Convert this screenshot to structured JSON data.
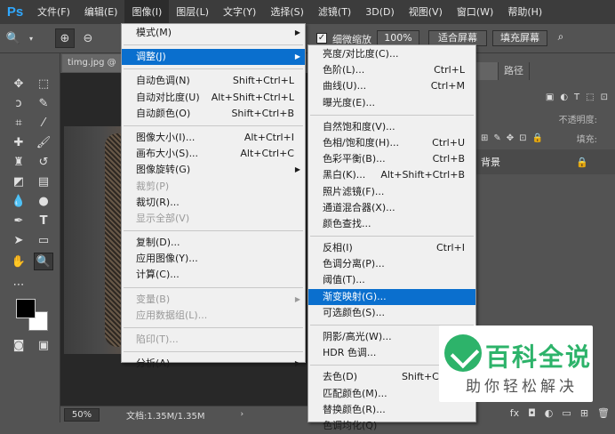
{
  "app": {
    "logo": "Ps"
  },
  "menubar": [
    {
      "label": "文件(F)"
    },
    {
      "label": "编辑(E)"
    },
    {
      "label": "图像(I)"
    },
    {
      "label": "图层(L)"
    },
    {
      "label": "文字(Y)"
    },
    {
      "label": "选择(S)"
    },
    {
      "label": "滤镜(T)"
    },
    {
      "label": "3D(D)"
    },
    {
      "label": "视图(V)"
    },
    {
      "label": "窗口(W)"
    },
    {
      "label": "帮助(H)"
    }
  ],
  "options": {
    "checkbox_label": "细微缩放",
    "zoom_value": "100%",
    "fit_screen": "适合屏幕",
    "fill_screen": "填充屏幕"
  },
  "document": {
    "tab": "timg.jpg @",
    "zoom": "50%",
    "doc_info": "文档:1.35M/1.35M"
  },
  "panel": {
    "tabs": [
      "",
      "路径"
    ],
    "opacity_label": "不透明度:",
    "fill_label": "填充:",
    "layer_name": "背景"
  },
  "image_menu": [
    {
      "label": "模式(M)",
      "shortcut": "",
      "submenu": true
    },
    {
      "sep": true
    },
    {
      "label": "调整(J)",
      "shortcut": "",
      "submenu": true,
      "highlight": true
    },
    {
      "sep": true
    },
    {
      "label": "自动色调(N)",
      "shortcut": "Shift+Ctrl+L"
    },
    {
      "label": "自动对比度(U)",
      "shortcut": "Alt+Shift+Ctrl+L"
    },
    {
      "label": "自动颜色(O)",
      "shortcut": "Shift+Ctrl+B"
    },
    {
      "sep": true
    },
    {
      "label": "图像大小(I)...",
      "shortcut": "Alt+Ctrl+I"
    },
    {
      "label": "画布大小(S)...",
      "shortcut": "Alt+Ctrl+C"
    },
    {
      "label": "图像旋转(G)",
      "shortcut": "",
      "submenu": true
    },
    {
      "label": "裁剪(P)",
      "shortcut": "",
      "disabled": true
    },
    {
      "label": "裁切(R)...",
      "shortcut": ""
    },
    {
      "label": "显示全部(V)",
      "shortcut": "",
      "disabled": true
    },
    {
      "sep": true
    },
    {
      "label": "复制(D)...",
      "shortcut": ""
    },
    {
      "label": "应用图像(Y)...",
      "shortcut": ""
    },
    {
      "label": "计算(C)...",
      "shortcut": ""
    },
    {
      "sep": true
    },
    {
      "label": "变量(B)",
      "shortcut": "",
      "submenu": true,
      "disabled": true
    },
    {
      "label": "应用数据组(L)...",
      "shortcut": "",
      "disabled": true
    },
    {
      "sep": true
    },
    {
      "label": "陷印(T)...",
      "shortcut": "",
      "disabled": true
    },
    {
      "sep": true
    },
    {
      "label": "分析(A)",
      "shortcut": "",
      "submenu": true
    }
  ],
  "adjust_menu": [
    {
      "label": "亮度/对比度(C)...",
      "shortcut": ""
    },
    {
      "label": "色阶(L)...",
      "shortcut": "Ctrl+L"
    },
    {
      "label": "曲线(U)...",
      "shortcut": "Ctrl+M"
    },
    {
      "label": "曝光度(E)...",
      "shortcut": ""
    },
    {
      "sep": true
    },
    {
      "label": "自然饱和度(V)...",
      "shortcut": ""
    },
    {
      "label": "色相/饱和度(H)...",
      "shortcut": "Ctrl+U"
    },
    {
      "label": "色彩平衡(B)...",
      "shortcut": "Ctrl+B"
    },
    {
      "label": "黑白(K)...",
      "shortcut": "Alt+Shift+Ctrl+B"
    },
    {
      "label": "照片滤镜(F)...",
      "shortcut": ""
    },
    {
      "label": "通道混合器(X)...",
      "shortcut": ""
    },
    {
      "label": "颜色查找...",
      "shortcut": ""
    },
    {
      "sep": true
    },
    {
      "label": "反相(I)",
      "shortcut": "Ctrl+I"
    },
    {
      "label": "色调分离(P)...",
      "shortcut": ""
    },
    {
      "label": "阈值(T)...",
      "shortcut": ""
    },
    {
      "label": "渐变映射(G)...",
      "shortcut": "",
      "highlight": true
    },
    {
      "label": "可选颜色(S)...",
      "shortcut": ""
    },
    {
      "sep": true
    },
    {
      "label": "阴影/高光(W)...",
      "shortcut": ""
    },
    {
      "label": "HDR 色调...",
      "shortcut": ""
    },
    {
      "sep": true
    },
    {
      "label": "去色(D)",
      "shortcut": "Shift+Ctrl+U"
    },
    {
      "label": "匹配颜色(M)...",
      "shortcut": ""
    },
    {
      "label": "替换颜色(R)...",
      "shortcut": ""
    },
    {
      "label": "色调均化(Q)",
      "shortcut": ""
    }
  ],
  "watermark": {
    "title": "百科全说",
    "subtitle": "助你轻松解决"
  }
}
